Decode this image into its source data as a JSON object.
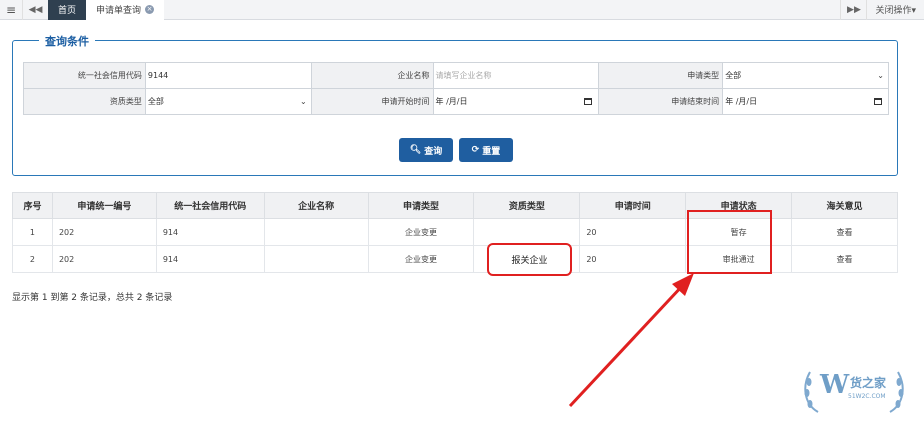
{
  "topbar": {
    "home_tab": "首页",
    "active_tab": "申请单查询",
    "close_ops": "关闭操作▾"
  },
  "query": {
    "legend": "查询条件",
    "credit_code_label": "统一社会信用代码",
    "credit_code_value": "9144",
    "company_name_label": "企业名称",
    "company_name_placeholder": "请填写企业名称",
    "apply_type_label": "申请类型",
    "apply_type_value": "全部",
    "qual_type_label": "资质类型",
    "qual_type_value": "全部",
    "start_time_label": "申请开始时间",
    "start_time_value": "年 /月/日",
    "end_time_label": "申请结束时间",
    "end_time_value": "年 /月/日",
    "search_button": "查询",
    "reset_button": "重置"
  },
  "table": {
    "headers": [
      "序号",
      "申请统一编号",
      "统一社会信用代码",
      "企业名称",
      "申请类型",
      "资质类型",
      "申请时间",
      "申请状态",
      "海关意见"
    ],
    "rows": [
      {
        "no": "1",
        "apply_id": "202",
        "credit_code": "914",
        "company": "",
        "apply_type": "企业变更",
        "qual_type": "",
        "apply_time": "20",
        "status": "暂存",
        "opinion": "查看"
      },
      {
        "no": "2",
        "apply_id": "202",
        "credit_code": "914",
        "company": "",
        "apply_type": "企业变更",
        "qual_type": "报关企业",
        "apply_time": "20",
        "status": "审批通过",
        "opinion": "查看"
      }
    ]
  },
  "summary": "显示第 1 到第 2 条记录，总共 2 条记录",
  "watermark": {
    "brand": "货之家",
    "url": "51W2C.COM"
  },
  "colors": {
    "accent": "#1f5ea0",
    "highlight": "#e02020",
    "home_tab_bg": "#2f4050"
  }
}
